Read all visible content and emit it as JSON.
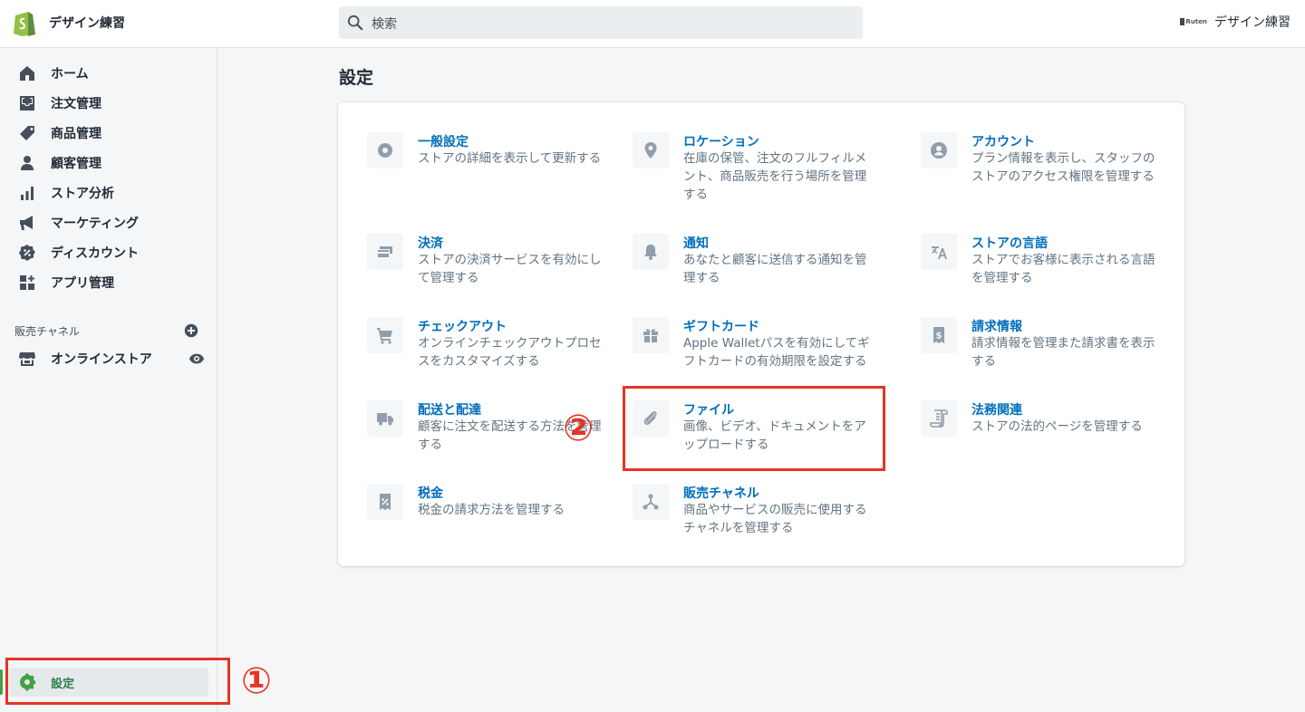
{
  "topbar": {
    "store_name": "デザイン練習",
    "search_placeholder": "検索",
    "account_brand": "Ruten",
    "account_name": "デザイン練習"
  },
  "sidebar": {
    "items": [
      {
        "label": "ホーム",
        "icon": "home-icon"
      },
      {
        "label": "注文管理",
        "icon": "orders-icon"
      },
      {
        "label": "商品管理",
        "icon": "tag-icon"
      },
      {
        "label": "顧客管理",
        "icon": "person-icon"
      },
      {
        "label": "ストア分析",
        "icon": "bar-chart-icon"
      },
      {
        "label": "マーケティング",
        "icon": "megaphone-icon"
      },
      {
        "label": "ディスカウント",
        "icon": "discount-icon"
      },
      {
        "label": "アプリ管理",
        "icon": "apps-icon"
      }
    ],
    "sales_channel_header": "販売チャネル",
    "online_store": "オンラインストア",
    "settings": "設定"
  },
  "main": {
    "title": "設定",
    "tiles": [
      {
        "title": "一般設定",
        "desc": "ストアの詳細を表示して更新する",
        "icon": "gear-icon"
      },
      {
        "title": "ロケーション",
        "desc": "在庫の保管、注文のフルフィルメント、商品販売を行う場所を管理する",
        "icon": "location-pin-icon"
      },
      {
        "title": "アカウント",
        "desc": "プラン情報を表示し、スタッフのストアのアクセス権限を管理する",
        "icon": "account-icon"
      },
      {
        "title": "決済",
        "desc": "ストアの決済サービスを有効にして管理する",
        "icon": "payment-icon"
      },
      {
        "title": "通知",
        "desc": "あなたと顧客に送信する通知を管理する",
        "icon": "bell-icon"
      },
      {
        "title": "ストアの言語",
        "desc": "ストアでお客様に表示される言語を管理する",
        "icon": "translate-icon"
      },
      {
        "title": "チェックアウト",
        "desc": "オンラインチェックアウトプロセスをカスタマイズする",
        "icon": "cart-icon"
      },
      {
        "title": "ギフトカード",
        "desc": "Apple Walletパスを有効にしてギフトカードの有効期限を設定する",
        "icon": "gift-icon"
      },
      {
        "title": "請求情報",
        "desc": "請求情報を管理また請求書を表示する",
        "icon": "billing-icon"
      },
      {
        "title": "配送と配達",
        "desc": "顧客に注文を配送する方法を管理する",
        "icon": "truck-icon"
      },
      {
        "title": "ファイル",
        "desc": "画像、ビデオ、ドキュメントをアップロードする",
        "icon": "paperclip-icon"
      },
      {
        "title": "法務関連",
        "desc": "ストアの法的ページを管理する",
        "icon": "legal-icon"
      },
      {
        "title": "税金",
        "desc": "税金の請求方法を管理する",
        "icon": "tax-icon"
      },
      {
        "title": "販売チャネル",
        "desc": "商品やサービスの販売に使用するチャネルを管理する",
        "icon": "channels-icon"
      }
    ]
  },
  "annotations": {
    "step1": "①",
    "step2": "②",
    "color": "#e53424"
  }
}
